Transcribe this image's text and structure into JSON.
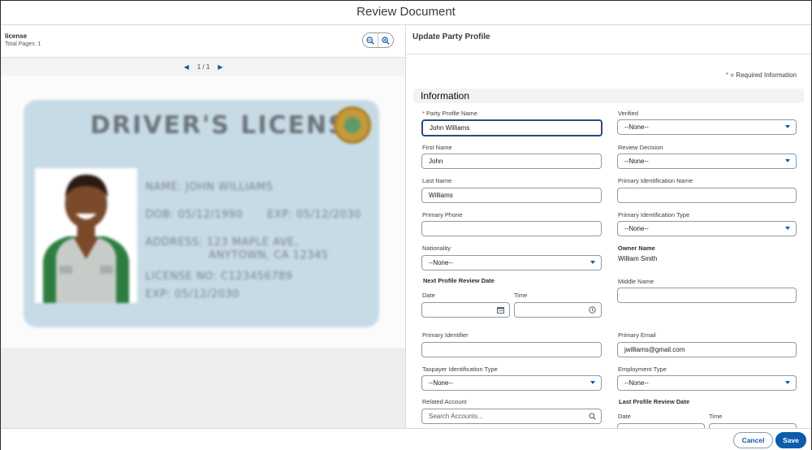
{
  "window": {
    "title": "Review Document"
  },
  "viewer": {
    "doc_name": "license",
    "total_pages": "Total Pages: 1",
    "pager": {
      "current": "1 / 1"
    },
    "license_card": {
      "title": "DRIVER'S LICENSE",
      "name_line": "NAME: JOHN WILLIAMS",
      "dob_line": "DOB: 05/12/1990",
      "exp_line_right": "EXP: 05/12/2030",
      "address_line1": "ADDRESS: 123 MAPLE AVE,",
      "address_line2": "ANYTOWN, CA 12345",
      "license_no": "LICENSE NO: C123456789",
      "exp_line": "EXP: 05/12/2030"
    }
  },
  "form": {
    "title": "Update Party Profile",
    "required_note": "= Required Information",
    "section_title": "Information",
    "fields": {
      "party_profile_name": {
        "label": "Party Profile Name",
        "value": "John Williams"
      },
      "verified": {
        "label": "Verified",
        "value": "--None--"
      },
      "first_name": {
        "label": "First Name",
        "value": "John"
      },
      "review_decision": {
        "label": "Review Decision",
        "value": "--None--"
      },
      "last_name": {
        "label": "Last Name",
        "value": "Williams"
      },
      "primary_identification_name": {
        "label": "Primary Identification Name",
        "value": ""
      },
      "primary_phone": {
        "label": "Primary Phone",
        "value": ""
      },
      "primary_identification_type": {
        "label": "Primary Identification Type",
        "value": "--None--"
      },
      "nationality": {
        "label": "Nationality",
        "value": "--None--"
      },
      "owner_name": {
        "label": "Owner Name",
        "value": "William Smith"
      },
      "next_profile_review_date": {
        "label": "Next Profile Review Date",
        "date_label": "Date",
        "time_label": "Time"
      },
      "middle_name": {
        "label": "Middle Name",
        "value": ""
      },
      "primary_identifier": {
        "label": "Primary Identifier",
        "value": ""
      },
      "primary_email": {
        "label": "Primary Email",
        "value": "jwilliams@gmail.com"
      },
      "taxpayer_identification_type": {
        "label": "Taxpayer Identification Type",
        "value": "--None--"
      },
      "employment_type": {
        "label": "Employment Type",
        "value": "--None--"
      },
      "related_account": {
        "label": "Related Account",
        "placeholder": "Search Accounts..."
      },
      "last_profile_review_date": {
        "label": "Last Profile Review Date",
        "date_label": "Date",
        "time_label": "Time"
      }
    }
  },
  "footer": {
    "cancel_label": "Cancel",
    "save_label": "Save"
  },
  "colors": {
    "brand": "#0b5cab",
    "required": "#c23934",
    "border": "#8e9aa6"
  },
  "icons": [
    "zoom-out-icon",
    "zoom-in-icon",
    "chevron-left-icon",
    "chevron-right-icon",
    "calendar-icon",
    "clock-icon",
    "search-icon",
    "dropdown-caret-icon"
  ]
}
